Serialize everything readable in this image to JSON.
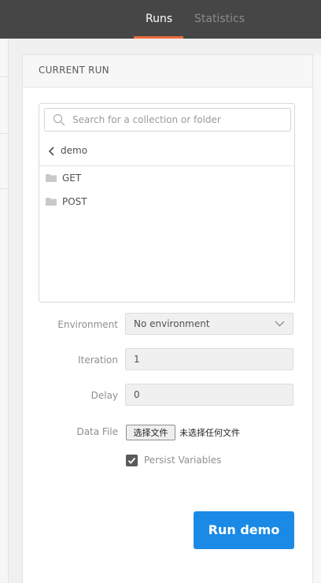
{
  "tabs": [
    {
      "label": "Runs",
      "active": true
    },
    {
      "label": "Statistics",
      "active": false
    }
  ],
  "panel": {
    "title": "CURRENT RUN"
  },
  "collection": {
    "search_placeholder": "Search for a collection or folder",
    "breadcrumb": "demo",
    "folders": [
      {
        "label": "GET"
      },
      {
        "label": "POST"
      }
    ]
  },
  "form": {
    "environment": {
      "label": "Environment",
      "value": "No environment"
    },
    "iteration": {
      "label": "Iteration",
      "value": "1"
    },
    "delay": {
      "label": "Delay",
      "value": "0"
    },
    "data_file": {
      "label": "Data File",
      "button": "选择文件",
      "status": "未选择任何文件"
    },
    "persist_variables": {
      "label": "Persist Variables",
      "checked": true
    }
  },
  "run_button": {
    "label": "Run demo"
  },
  "colors": {
    "topbar": "#464646",
    "active_tab_underline": "#f26b3a",
    "primary_button": "#1a8ae6"
  },
  "icons": [
    "search-icon",
    "chevron-left-icon",
    "folder-icon",
    "chevron-down-icon",
    "checkmark-icon"
  ]
}
